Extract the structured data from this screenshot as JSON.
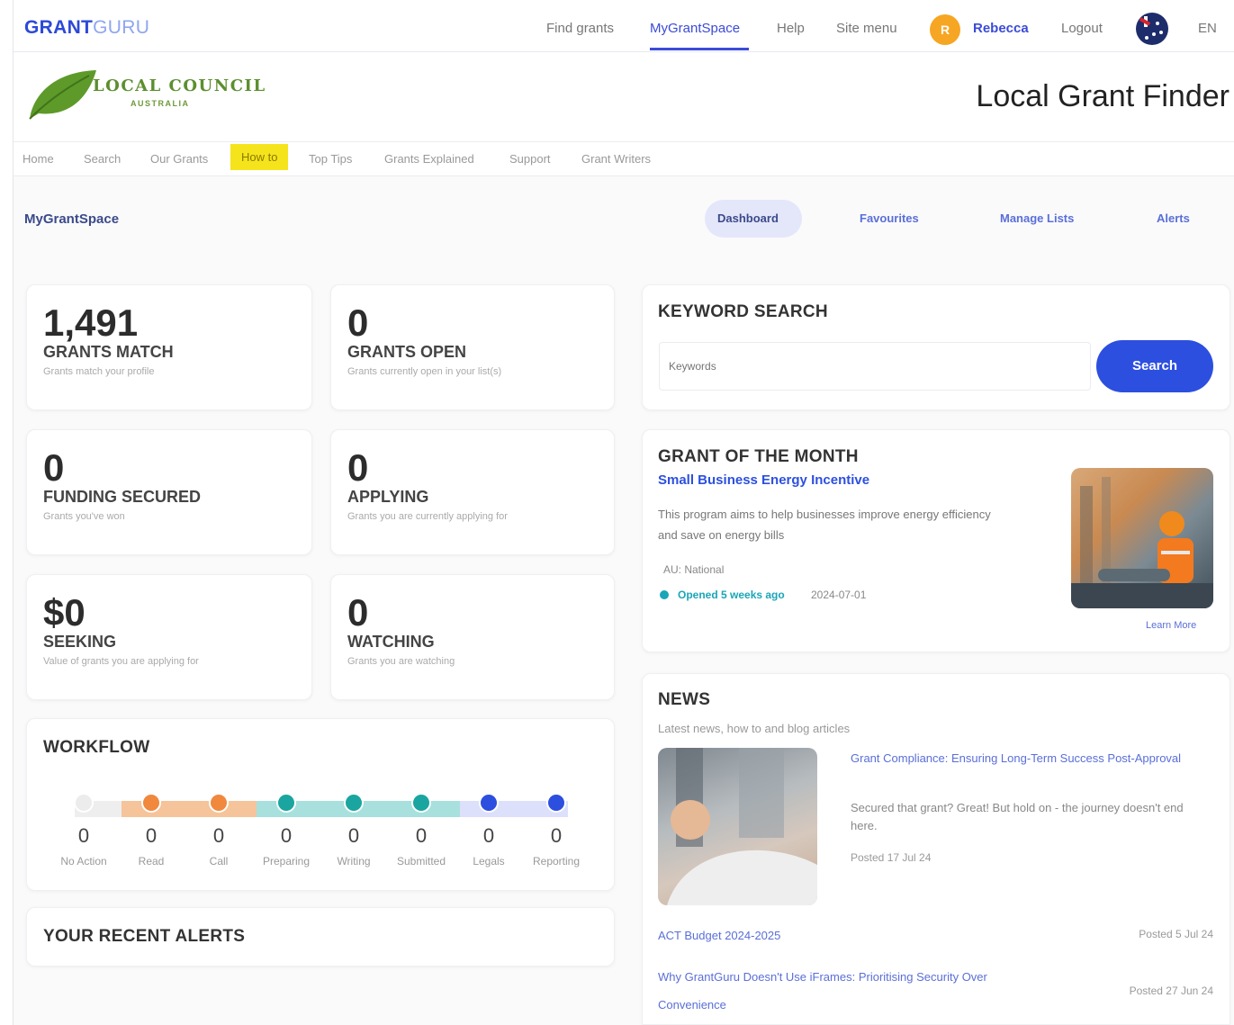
{
  "topnav": {
    "brand_part1": "GRANT",
    "brand_part2": "GURU",
    "links": [
      "Find grants",
      "MyGrantSpace",
      "Help",
      "Site menu"
    ],
    "avatar_initial": "R",
    "user": "Rebecca",
    "logout": "Logout",
    "lang": "EN",
    "accent": "#3b4bd8"
  },
  "header": {
    "org_line1": "LOCAL COUNCIL",
    "org_line2": "AUSTRALIA",
    "title": "Local Grant Finder"
  },
  "subnav": [
    "Home",
    "Search",
    "Our Grants",
    "How to",
    "Top Tips",
    "Grants Explained",
    "Support",
    "Grant Writers"
  ],
  "mygrantspace": {
    "title": "MyGrantSpace",
    "tabs": [
      "Dashboard",
      "Favourites",
      "Manage Lists",
      "Alerts"
    ],
    "active_tab": "Dashboard"
  },
  "stats": [
    {
      "value": "1,491",
      "label": "GRANTS MATCH",
      "sub": "Grants match your profile"
    },
    {
      "value": "0",
      "label": "GRANTS OPEN",
      "sub": "Grants currently open in your list(s)"
    },
    {
      "value": "0",
      "label": "FUNDING SECURED",
      "sub": "Grants you've won"
    },
    {
      "value": "0",
      "label": "APPLYING",
      "sub": "Grants you are currently applying for"
    },
    {
      "value": "$0",
      "label": "SEEKING",
      "sub": "Value of grants you are applying for"
    },
    {
      "value": "0",
      "label": "WATCHING",
      "sub": "Grants you are watching"
    }
  ],
  "workflow": {
    "title": "WORKFLOW",
    "stages": [
      {
        "count": "0",
        "label": "No Action",
        "color": "#e6e6e6"
      },
      {
        "count": "0",
        "label": "Read",
        "color": "#f0883e"
      },
      {
        "count": "0",
        "label": "Call",
        "color": "#f0883e"
      },
      {
        "count": "0",
        "label": "Preparing",
        "color": "#1aa5a0"
      },
      {
        "count": "0",
        "label": "Writing",
        "color": "#1aa5a0"
      },
      {
        "count": "0",
        "label": "Submitted",
        "color": "#1aa5a0"
      },
      {
        "count": "0",
        "label": "Legals",
        "color": "#2c4fe0"
      },
      {
        "count": "0",
        "label": "Reporting",
        "color": "#2c4fe0"
      }
    ]
  },
  "alerts": {
    "title": "YOUR RECENT ALERTS"
  },
  "keyword": {
    "title": "KEYWORD SEARCH",
    "placeholder": "Keywords",
    "button": "Search"
  },
  "grant_month": {
    "title": "GRANT OF THE MONTH",
    "name": "Small Business Energy Incentive",
    "desc": "This program aims to help businesses improve energy efficiency and save on energy bills",
    "location": "AU: National",
    "opened": "Opened 5 weeks ago",
    "date": "2024-07-01",
    "learn_more": "Learn More",
    "image_icon": "worker-photo"
  },
  "news": {
    "title": "NEWS",
    "subtitle": "Latest news, how to and blog articles",
    "featured": {
      "title": "Grant Compliance: Ensuring Long-Term Success Post-Approval",
      "desc": "Secured that grant? Great! But hold on - the journey doesn't end here.",
      "posted": "Posted 17 Jul 24"
    },
    "items": [
      {
        "title": "ACT Budget 2024-2025",
        "date": "Posted 5 Jul 24"
      },
      {
        "title": "Why GrantGuru Doesn't Use iFrames: Prioritising Security Over Convenience",
        "date": "Posted 27 Jun 24"
      }
    ]
  }
}
